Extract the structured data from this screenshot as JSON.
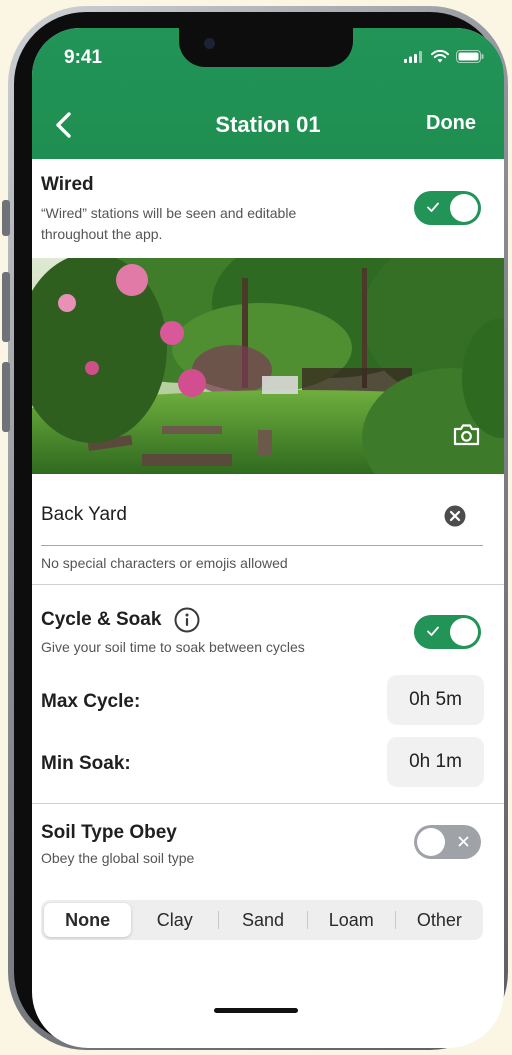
{
  "status_bar": {
    "time": "9:41"
  },
  "nav": {
    "title": "Station 01",
    "done_label": "Done"
  },
  "wired": {
    "title": "Wired",
    "description": "“Wired” stations will be seen and editable throughout the app.",
    "toggle_on": true
  },
  "name_field": {
    "value": "Back Yard",
    "helper": "No special characters or emojis allowed"
  },
  "cycle_soak": {
    "title": "Cycle & Soak",
    "description": "Give your soil time to soak between cycles",
    "toggle_on": true,
    "max_cycle_label": "Max Cycle:",
    "max_cycle_value": "0h 5m",
    "min_soak_label": "Min Soak:",
    "min_soak_value": "0h 1m"
  },
  "soil_type": {
    "title": "Soil Type Obey",
    "description": "Obey the global soil type",
    "toggle_on": false,
    "options": [
      "None",
      "Clay",
      "Sand",
      "Loam",
      "Other"
    ],
    "selected": "None"
  },
  "colors": {
    "brand_green": "#229457",
    "toggle_off": "#9fa3a8"
  },
  "icons": [
    "back-chevron-icon",
    "signal-icon",
    "wifi-icon",
    "battery-icon",
    "camera-icon",
    "clear-icon",
    "info-icon",
    "check-icon",
    "x-icon"
  ]
}
